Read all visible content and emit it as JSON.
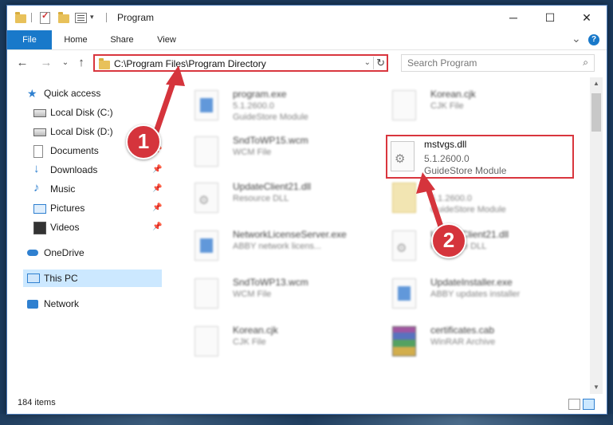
{
  "window": {
    "title": "Program",
    "controls": {
      "minimize": "─",
      "maximize": "☐",
      "close": "✕"
    }
  },
  "ribbon": {
    "tabs": [
      "File",
      "Home",
      "Share",
      "View"
    ],
    "expand": "⌄",
    "help": "?"
  },
  "address": {
    "path": "C:\\Program Files\\Program Directory",
    "dropdown": "⌄",
    "refresh": "↻"
  },
  "search": {
    "placeholder": "Search Program",
    "icon": "⌕"
  },
  "nav": {
    "back": "←",
    "forward": "→",
    "recent": "⌄",
    "up": "↑",
    "items": [
      {
        "label": "Quick access",
        "icon": "star-icon"
      },
      {
        "label": "Local Disk (C:)",
        "icon": "disk-icon",
        "pin": "📌"
      },
      {
        "label": "Local Disk (D:)",
        "icon": "disk-icon",
        "pin": "📌"
      },
      {
        "label": "Documents",
        "icon": "document-icon",
        "pin": "📌"
      },
      {
        "label": "Downloads",
        "icon": "download-icon",
        "pin": "📌"
      },
      {
        "label": "Music",
        "icon": "music-icon",
        "pin": "📌"
      },
      {
        "label": "Pictures",
        "icon": "picture-icon",
        "pin": "📌"
      },
      {
        "label": "Videos",
        "icon": "video-icon",
        "pin": "📌"
      },
      {
        "label": "OneDrive",
        "icon": "cloud-icon"
      },
      {
        "label": "This PC",
        "icon": "computer-icon",
        "selected": true
      },
      {
        "label": "Network",
        "icon": "network-icon"
      }
    ]
  },
  "files": [
    {
      "name": "program.exe",
      "line2": "5.1.2600.0",
      "line3": "GuideStore Module"
    },
    {
      "name": "Korean.cjk",
      "line2": "CJK File"
    },
    {
      "name": "SndToWP15.wcm",
      "line2": "WCM File"
    },
    {
      "name": "mstvgs.dll",
      "line2": "5.1.2600.0",
      "line3": "GuideStore Module",
      "highlighted": true
    },
    {
      "name": "UpdateClient21.dll",
      "line2": "Resource DLL"
    },
    {
      "name": "",
      "line2": "5.1.2600.0",
      "line3": "GuideStore Module"
    },
    {
      "name": "NetworkLicenseServer.exe",
      "line2": "ABBY network licens..."
    },
    {
      "name": "UpdateClient21.dll",
      "line2": "Resource DLL"
    },
    {
      "name": "SndToWP13.wcm",
      "line2": "WCM File"
    },
    {
      "name": "UpdateInstaller.exe",
      "line2": "ABBY updates installer"
    },
    {
      "name": "Korean.cjk",
      "line2": "CJK File"
    },
    {
      "name": "certificates.cab",
      "line2": "WinRAR Archive"
    }
  ],
  "annotations": {
    "step1": "1",
    "step2": "2",
    "color": "#d5343c"
  },
  "status": {
    "count": "184 items"
  },
  "accent": "#1979ca"
}
